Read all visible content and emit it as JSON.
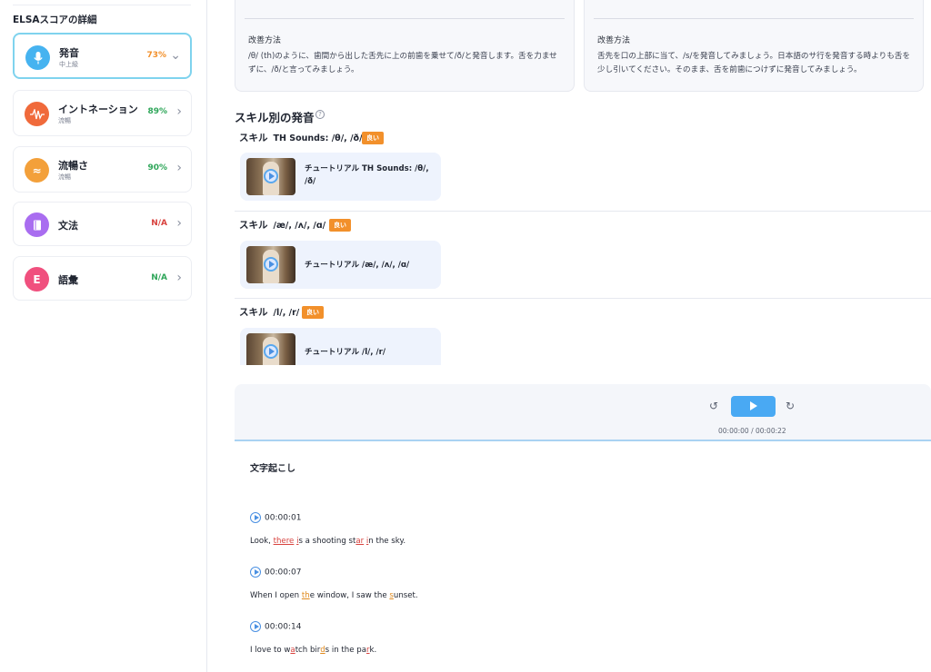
{
  "sidebar": {
    "title": "ELSAスコアの詳細",
    "items": [
      {
        "label": "発音",
        "sub": "中上級",
        "value": "73%",
        "color": "#f2902b",
        "icon": "mic-icon",
        "icon_color": "#46b3f0",
        "active": true,
        "chevron": "⌄"
      },
      {
        "label": "イントネーション",
        "sub": "流暢",
        "value": "89%",
        "color": "#2fa65a",
        "icon": "wave-icon",
        "icon_color": "#f06a3b",
        "active": false,
        "chevron": "›"
      },
      {
        "label": "流暢さ",
        "sub": "流暢",
        "value": "90%",
        "color": "#2fa65a",
        "icon": "approx-icon",
        "icon_color": "#f3a03a",
        "active": false,
        "chevron": "›"
      },
      {
        "label": "文法",
        "sub": "",
        "value": "N/A",
        "color": "#d8423e",
        "icon": "book-icon",
        "icon_color": "#a96df0",
        "active": false,
        "chevron": "›"
      },
      {
        "label": "語彙",
        "sub": "",
        "value": "N/A",
        "color": "#2fa65a",
        "icon": "letter-e-icon",
        "icon_glyph": "E",
        "icon_color": "#f0507e",
        "active": false,
        "chevron": "›"
      }
    ]
  },
  "tips": [
    {
      "heading": "改善方法",
      "body": "/θ/ (th)のように、歯間から出した舌先に上の前歯を乗せて/ð/と発音します。舌を力ませずに、/ð/と言ってみましょう。"
    },
    {
      "heading": "改善方法",
      "body": "舌先を口の上部に当て、/s/を発音してみましょう。日本語のサ行を発音する時よりも舌を少し引いてください。そのまま、舌を前歯につけずに発音してみましょう。"
    }
  ],
  "skills_section": {
    "title": "スキル別の発音",
    "help": "?",
    "skills": [
      {
        "prefix": "スキル",
        "name": "TH Sounds: /θ/, /ð/",
        "badge": "良い",
        "tutorial": "チュートリアル TH Sounds: /θ/, /ð/"
      },
      {
        "prefix": "スキル",
        "name": "/æ/, /ʌ/, /ɑ/",
        "badge": "良い",
        "tutorial": "チュートリアル /æ/, /ʌ/, /ɑ/"
      },
      {
        "prefix": "スキル",
        "name": "/l/, /r/",
        "badge": "良い",
        "tutorial": "チュートリアル /l/, /r/"
      }
    ]
  },
  "player": {
    "time": "00:00:00 / 00:00:22",
    "rewind_icon": "↺",
    "forward_icon": "↻"
  },
  "transcript": {
    "title": "文字起こし",
    "entries": [
      {
        "time": "00:00:01",
        "segments": [
          [
            "Look, ",
            ""
          ],
          [
            "there",
            "r"
          ],
          [
            " ",
            ""
          ],
          [
            "i",
            "r"
          ],
          [
            "s a shooting st",
            ""
          ],
          [
            "ar",
            "r"
          ],
          [
            " ",
            ""
          ],
          [
            "i",
            "r"
          ],
          [
            "n the sky.",
            ""
          ]
        ]
      },
      {
        "time": "00:00:07",
        "segments": [
          [
            "When I open ",
            ""
          ],
          [
            "th",
            "o"
          ],
          [
            "e window, I saw the ",
            ""
          ],
          [
            "s",
            "o"
          ],
          [
            "unset.",
            ""
          ]
        ]
      },
      {
        "time": "00:00:14",
        "segments": [
          [
            "I love to w",
            ""
          ],
          [
            "a",
            "r"
          ],
          [
            "tch bir",
            ""
          ],
          [
            "d",
            "o"
          ],
          [
            "s in the pa",
            ""
          ],
          [
            "r",
            "r"
          ],
          [
            "k.",
            ""
          ]
        ]
      }
    ]
  }
}
